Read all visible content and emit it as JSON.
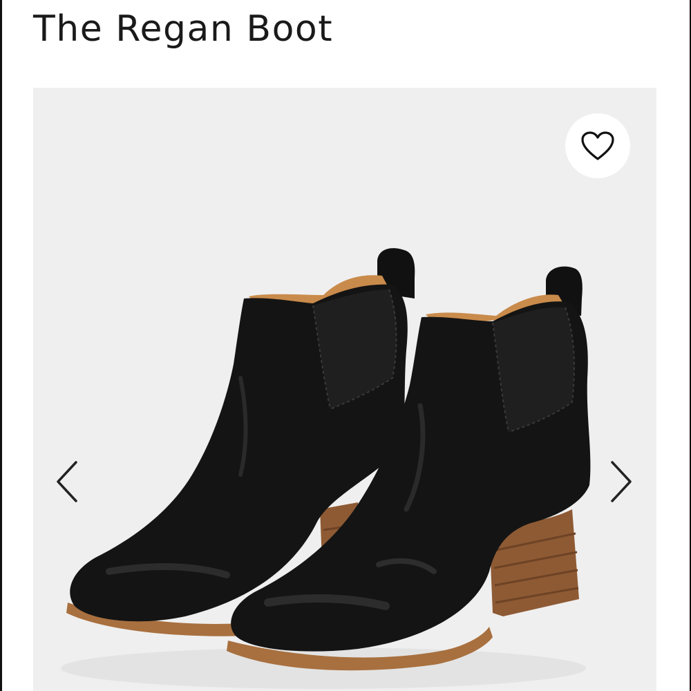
{
  "product": {
    "title": "The Regan Boot"
  },
  "gallery": {
    "image_icon": "ankle-boots-photo",
    "favorite_icon": "heart-outline-icon",
    "prev_icon": "chevron-left-icon",
    "next_icon": "chevron-right-icon",
    "background_color": "#efefef"
  },
  "colors": {
    "title_text": "#1a1a1a",
    "leather": "#141414",
    "lining": "#c98b4b",
    "heel": "#8e5a34"
  }
}
